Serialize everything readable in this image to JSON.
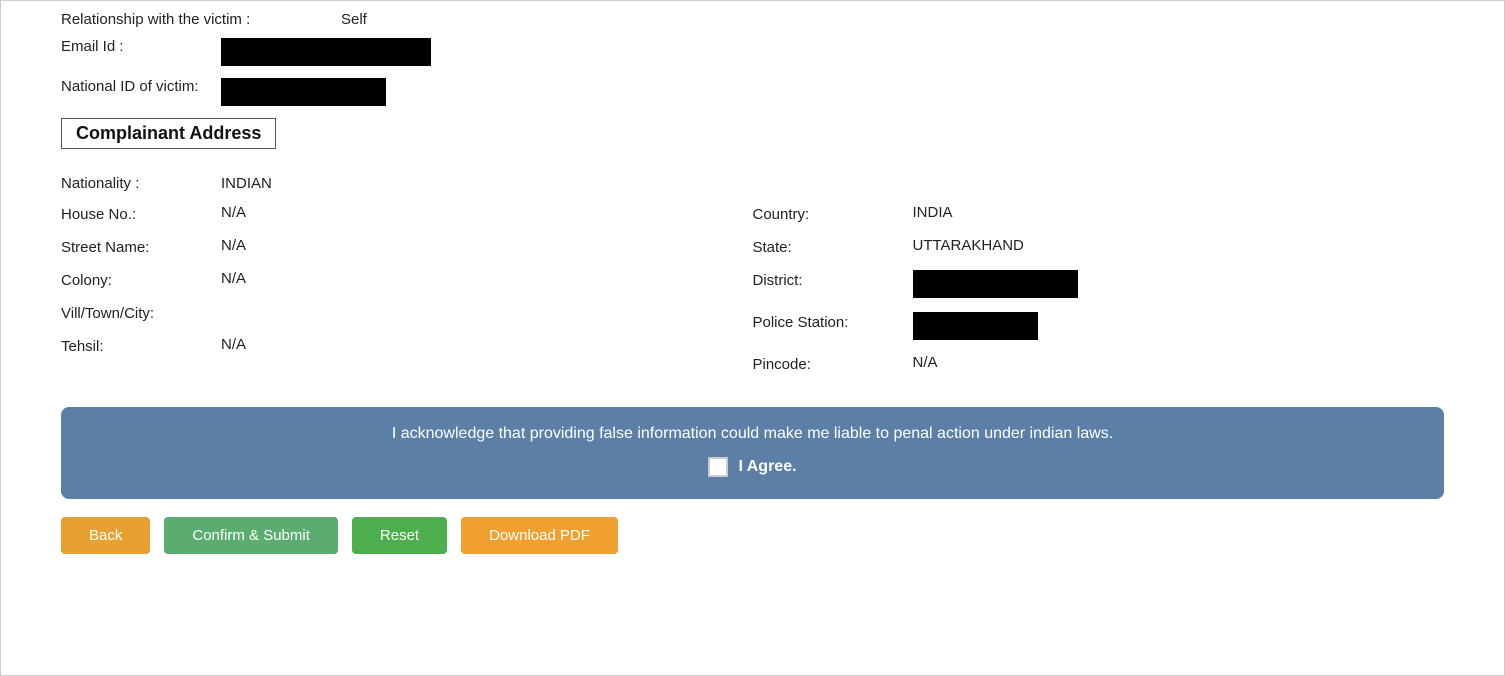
{
  "top": {
    "relationship_label": "Relationship with the victim :",
    "relationship_value": "Self",
    "email_label": "Email Id :",
    "national_id_label": "National ID of victim:"
  },
  "address_section": {
    "heading": "Complainant Address",
    "nationality_label": "Nationality :",
    "nationality_value": "INDIAN",
    "left": {
      "house_no_label": "House No.:",
      "house_no_value": "N/A",
      "street_name_label": "Street Name:",
      "street_name_value": "N/A",
      "colony_label": "Colony:",
      "colony_value": "N/A",
      "vill_town_city_label": "Vill/Town/City:",
      "vill_town_city_value": "",
      "tehsil_label": "Tehsil:",
      "tehsil_value": "N/A"
    },
    "right": {
      "country_label": "Country:",
      "country_value": "INDIA",
      "state_label": "State:",
      "state_value": "UTTARAKHAND",
      "district_label": "District:",
      "police_station_label": "Police Station:",
      "pincode_label": "Pincode:",
      "pincode_value": "N/A"
    }
  },
  "acknowledge": {
    "text": "I acknowledge that providing false information could make me liable to penal action under indian laws.",
    "agree_label": "I Agree."
  },
  "buttons": {
    "back": "Back",
    "confirm": "Confirm & Submit",
    "reset": "Reset",
    "download": "Download PDF"
  }
}
